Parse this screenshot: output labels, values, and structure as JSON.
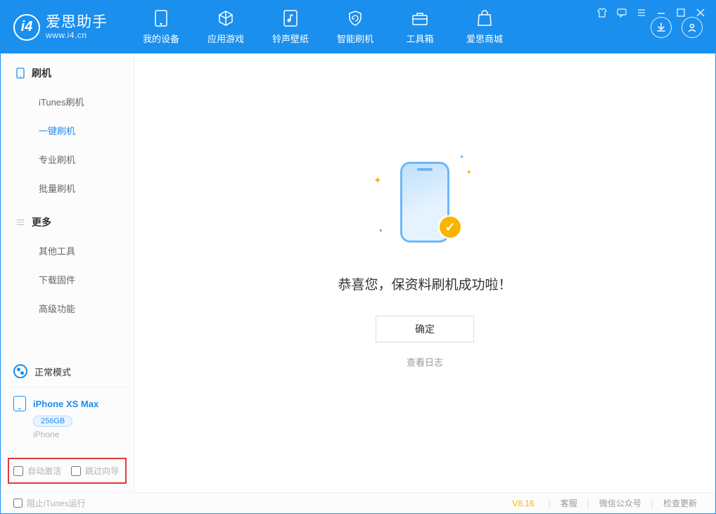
{
  "brand": {
    "title": "爱思助手",
    "subtitle": "www.i4.cn"
  },
  "nav": [
    {
      "label": "我的设备"
    },
    {
      "label": "应用游戏"
    },
    {
      "label": "铃声壁纸"
    },
    {
      "label": "智能刷机"
    },
    {
      "label": "工具箱"
    },
    {
      "label": "爱思商城"
    }
  ],
  "sidebar": {
    "flash_group": "刷机",
    "items_flash": [
      {
        "label": "iTunes刷机"
      },
      {
        "label": "一键刷机"
      },
      {
        "label": "专业刷机"
      },
      {
        "label": "批量刷机"
      }
    ],
    "more_group": "更多",
    "items_more": [
      {
        "label": "其他工具"
      },
      {
        "label": "下载固件"
      },
      {
        "label": "高级功能"
      }
    ]
  },
  "status": {
    "mode": "正常模式",
    "device_name": "iPhone XS Max",
    "storage": "256GB",
    "device_type": "iPhone"
  },
  "options": {
    "auto_activate": "自动激活",
    "skip_guide": "跳过向导"
  },
  "main": {
    "success_msg": "恭喜您，保资料刷机成功啦！",
    "confirm": "确定",
    "view_log": "查看日志"
  },
  "footer": {
    "block_itunes": "阻止iTunes运行",
    "version": "V8.16",
    "links": [
      "客服",
      "微信公众号",
      "检查更新"
    ]
  }
}
